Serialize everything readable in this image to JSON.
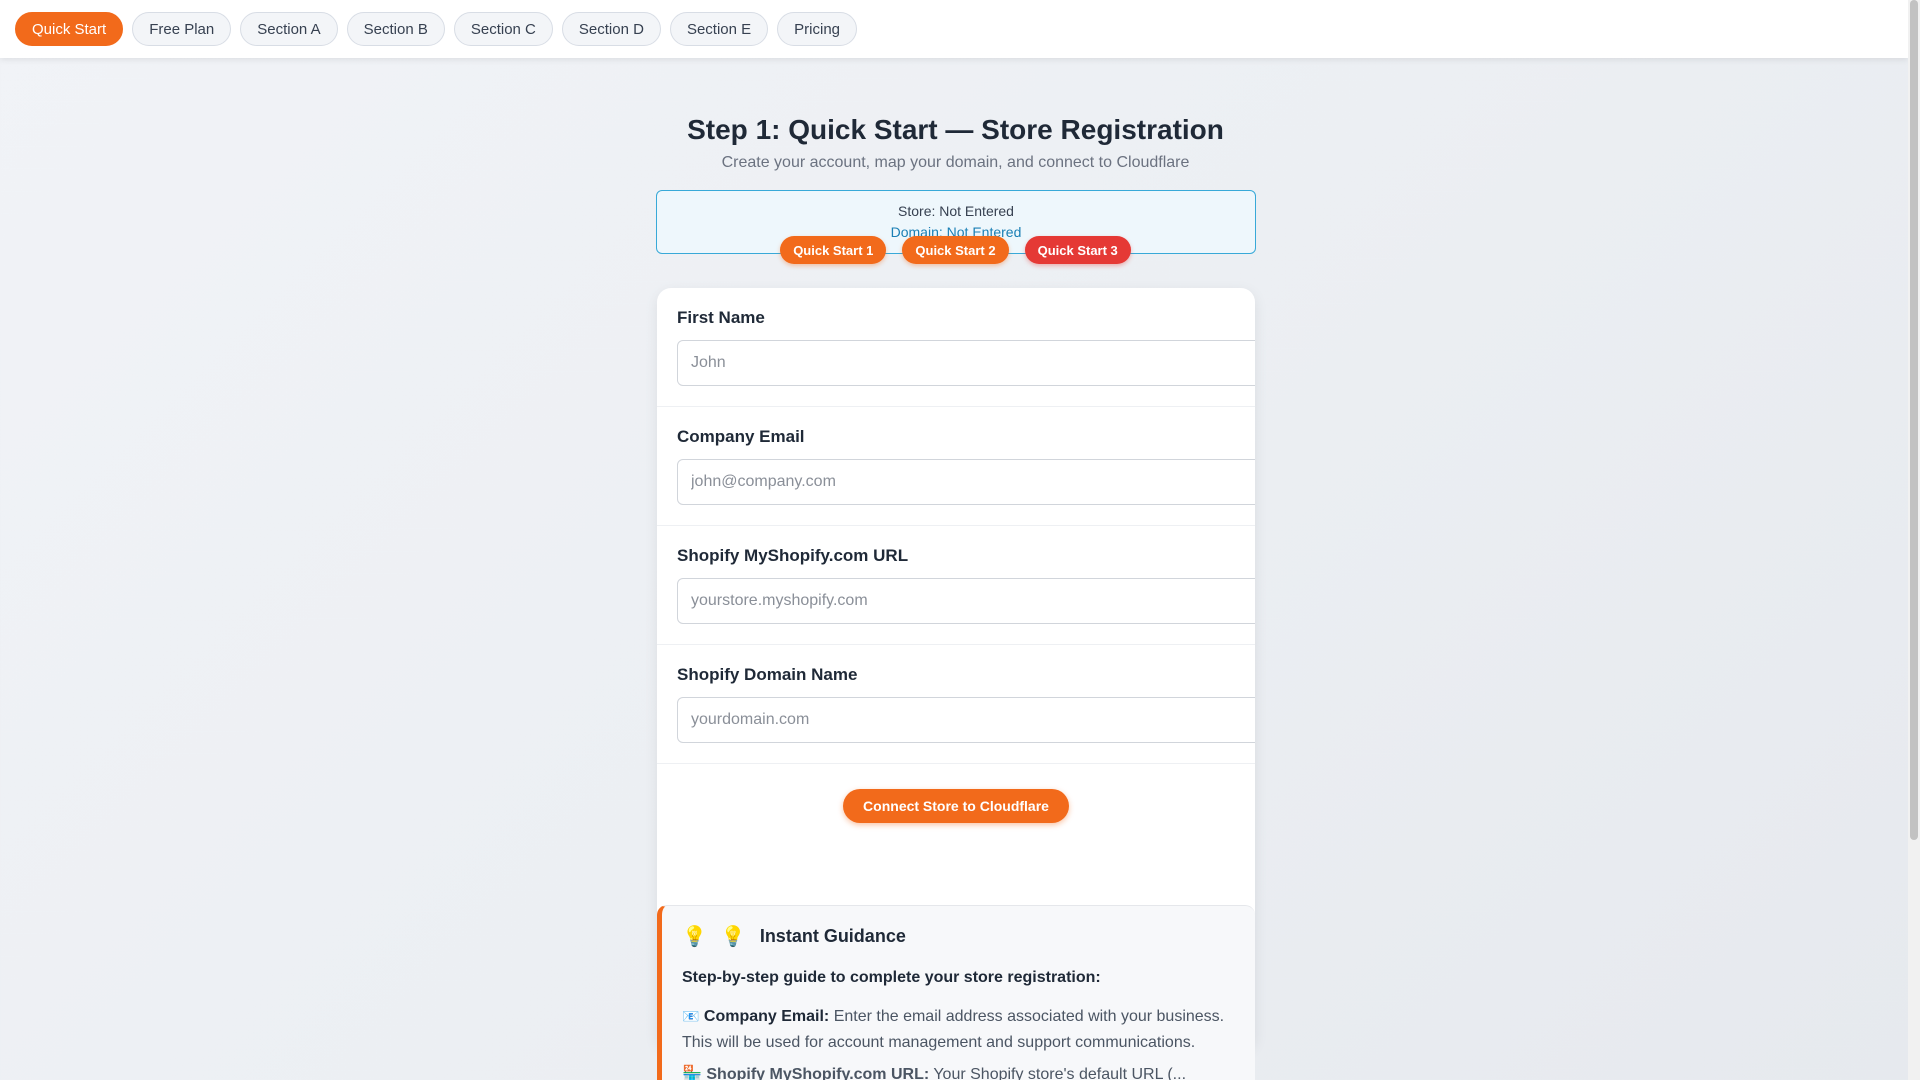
{
  "nav": {
    "tabs": [
      {
        "label": "Quick Start",
        "active": true
      },
      {
        "label": "Free Plan"
      },
      {
        "label": "Section A"
      },
      {
        "label": "Section B"
      },
      {
        "label": "Section C"
      },
      {
        "label": "Section D"
      },
      {
        "label": "Section E"
      },
      {
        "label": "Pricing"
      }
    ]
  },
  "header": {
    "title": "Step 1: Quick Start — Store Registration",
    "subtitle": "Create your account, map your domain, and connect to Cloudflare"
  },
  "status": {
    "store": "Store: Not Entered",
    "domain": "Domain: Not Entered"
  },
  "quick_start": {
    "buttons": [
      "Quick Start 1",
      "Quick Start 2",
      "Quick Start 3"
    ]
  },
  "form": {
    "fields": [
      {
        "label": "First Name",
        "placeholder": "John"
      },
      {
        "label": "Company Email",
        "placeholder": "john@company.com"
      },
      {
        "label": "Shopify MyShopify.com URL",
        "placeholder": "yourstore.myshopify.com"
      },
      {
        "label": "Shopify Domain Name",
        "placeholder": "yourdomain.com"
      }
    ],
    "submit_label": "Connect Store to Cloudflare"
  },
  "guidance": {
    "icons": [
      "lightbulb-icon",
      "lightbulb-icon"
    ],
    "bulb_glyph": "💡",
    "title": "Instant Guidance",
    "intro": "Step-by-step guide to complete your store registration:",
    "items": [
      {
        "icon_glyph": "📧",
        "term": "Company Email:",
        "text": "Enter the email address associated with your business. This will be used for account management and support communications."
      },
      {
        "icon_glyph": "🏪",
        "term": "Shopify MyShopify.com URL:",
        "text": "Your Shopify store's default URL (..."
      }
    ]
  },
  "colors": {
    "accent": "#f26a1b",
    "danger": "#e53935",
    "info": "#1a7fb5"
  }
}
